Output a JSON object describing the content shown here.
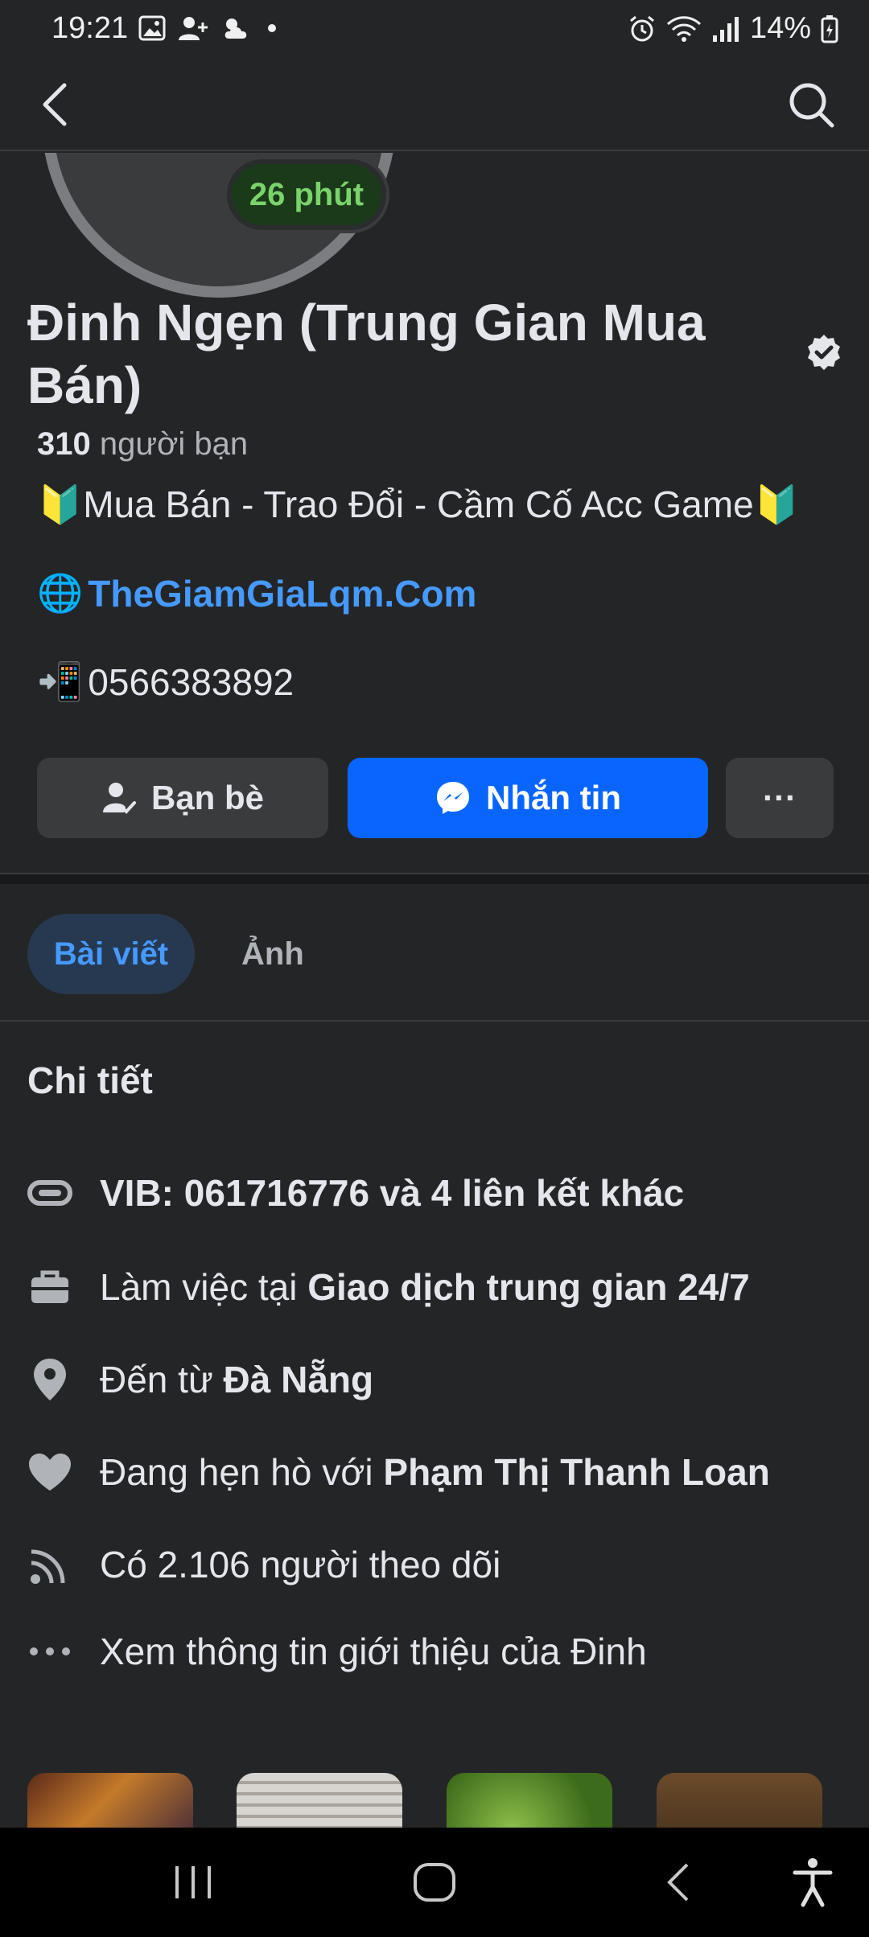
{
  "status_bar": {
    "time": "19:21",
    "battery_percent": "14%"
  },
  "profile": {
    "active_badge": "26 phút",
    "name": "Đinh Ngẹn (Trung Gian Mua Bán)",
    "friends_count": "310",
    "friends_label": "người bạn",
    "bio": "🔰Mua Bán - Trao Đổi - Cầm Cố Acc Game🔰",
    "website_emoji": "🌐",
    "website": "TheGiamGiaLqm.Com",
    "phone_emoji": "📲",
    "phone": "0566383892"
  },
  "actions": {
    "friends_label": "Bạn bè",
    "message_label": "Nhắn tin",
    "more_label": "···"
  },
  "tabs": {
    "posts": "Bài viết",
    "photos": "Ảnh"
  },
  "details": {
    "title": "Chi tiết",
    "link_bold": "VIB: 061716776",
    "link_rest": " và 4 liên kết khác",
    "work_prefix": "Làm việc tại ",
    "work_place": "Giao dịch trung gian 24/7",
    "from_prefix": "Đến từ ",
    "from_place": "Đà Nẵng",
    "dating_prefix": "Đang hẹn hò với ",
    "dating_person": "Phạm Thị Thanh Loan",
    "followers": "Có 2.106 người theo dõi",
    "see_intro": "Xem thông tin giới thiệu của Đinh"
  },
  "colors": {
    "background": "#242527",
    "accent_blue": "#0866ff",
    "link_blue": "#4599ff",
    "badge_green": "#7bd36b"
  }
}
